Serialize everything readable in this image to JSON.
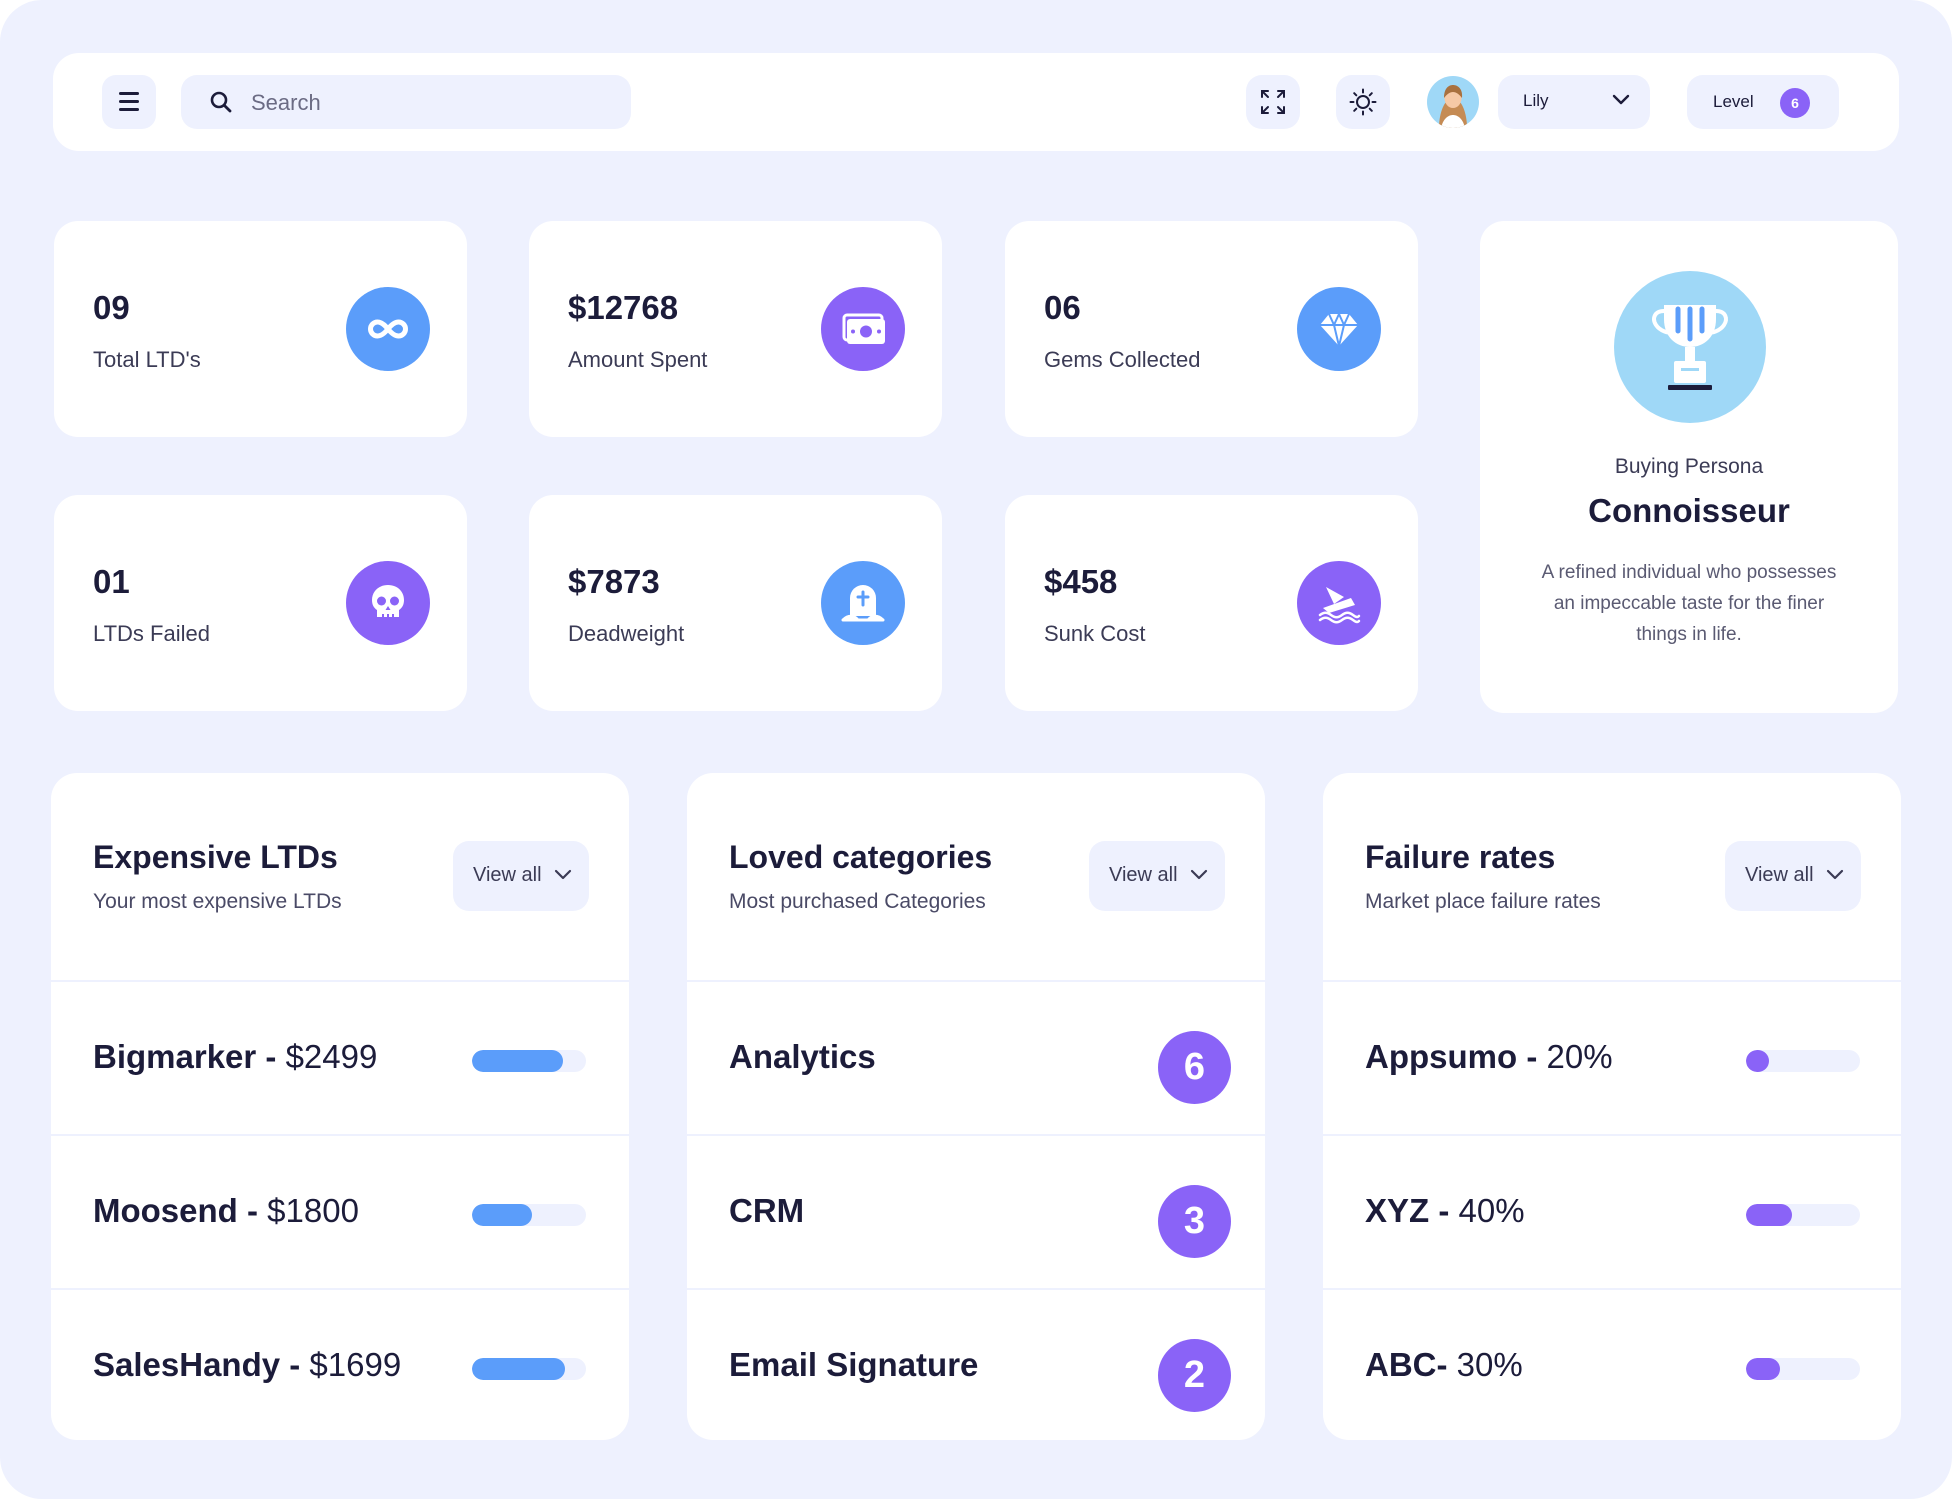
{
  "colors": {
    "background": "#eef1fe",
    "blue": "#5b9dfa",
    "purple": "#8a63f7",
    "light_blue": "#9fd8f7"
  },
  "topbar": {
    "search_placeholder": "Search",
    "user_name": "Lily",
    "level_label": "Level",
    "level_value": "6",
    "icons": [
      "menu-icon",
      "search-icon",
      "fullscreen-icon",
      "sun-icon",
      "chevron-down-icon"
    ]
  },
  "stats": [
    {
      "value": "09",
      "label": "Total LTD's",
      "icon": "infinity-icon",
      "color": "blue"
    },
    {
      "value": "$12768",
      "label": "Amount Spent",
      "icon": "banknote-icon",
      "color": "purple"
    },
    {
      "value": "06",
      "label": "Gems Collected",
      "icon": "diamond-icon",
      "color": "blue"
    },
    {
      "value": "01",
      "label": "LTDs Failed",
      "icon": "skull-icon",
      "color": "purple"
    },
    {
      "value": "$7873",
      "label": "Deadweight",
      "icon": "tombstone-icon",
      "color": "blue"
    },
    {
      "value": "$458",
      "label": "Sunk Cost",
      "icon": "sinking-ship-icon",
      "color": "purple"
    }
  ],
  "persona": {
    "label": "Buying Persona",
    "title": "Connoisseur",
    "description": "A refined individual who possesses an impeccable taste for the finer things in life."
  },
  "panels": {
    "expensive": {
      "title": "Expensive LTDs",
      "subtitle": "Your most expensive LTDs",
      "view_all": "View all",
      "items": [
        {
          "name": "Bigmarker",
          "amount": "$2499",
          "level": 0.8
        },
        {
          "name": "Moosend",
          "amount": "$1800",
          "level": 0.53
        },
        {
          "name": "SalesHandy",
          "amount": "$1699",
          "level": 0.82
        }
      ]
    },
    "categories": {
      "title": "Loved categories",
      "subtitle": "Most purchased Categories",
      "view_all": "View all",
      "items": [
        {
          "name": "Analytics",
          "count": "6"
        },
        {
          "name": "CRM",
          "count": "3"
        },
        {
          "name": "Email Signature",
          "count": "2"
        }
      ]
    },
    "failure": {
      "title": "Failure rates",
      "subtitle": "Market place failure rates",
      "view_all": "View all",
      "items": [
        {
          "name": "Appsumo",
          "sep": " - ",
          "rate": "20%",
          "level": 0.2
        },
        {
          "name": "XYZ",
          "sep": " - ",
          "rate": "40%",
          "level": 0.4
        },
        {
          "name": "ABC",
          "sep": "- ",
          "rate": "30%",
          "level": 0.3
        }
      ]
    }
  }
}
